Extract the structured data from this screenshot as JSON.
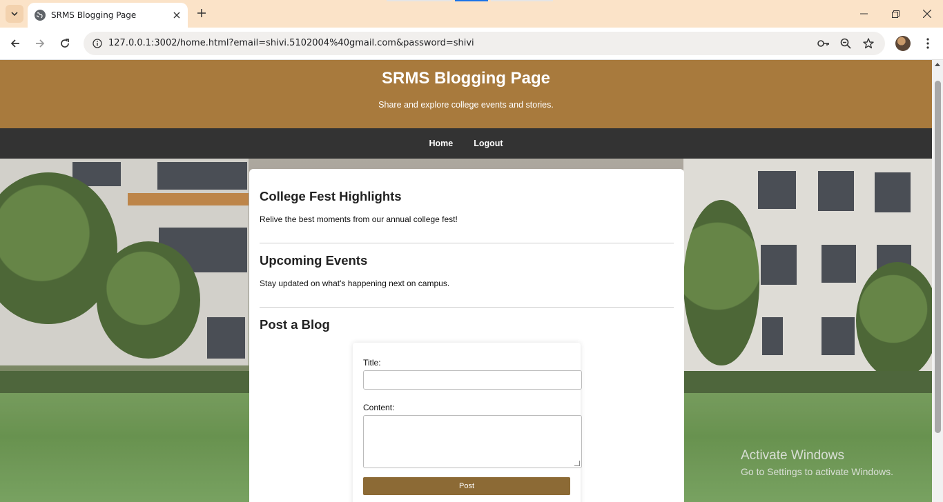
{
  "browser": {
    "tab_title": "SRMS Blogging Page",
    "url": "127.0.0.1:3002/home.html?email=shivi.5102004%40gmail.com&password=shivi",
    "icons": [
      "tab-search-icon",
      "globe-icon",
      "close-icon",
      "plus-icon",
      "minimize-icon",
      "restore-icon",
      "close-window-icon",
      "back-icon",
      "forward-icon",
      "reload-icon",
      "site-info-icon",
      "key-icon",
      "zoom-icon",
      "star-icon",
      "avatar",
      "more-icon"
    ]
  },
  "header": {
    "title": "SRMS Blogging Page",
    "subtitle": "Share and explore college events and stories."
  },
  "nav": {
    "home": "Home",
    "logout": "Logout"
  },
  "sections": [
    {
      "heading": "College Fest Highlights",
      "text": "Relive the best moments from our annual college fest!"
    },
    {
      "heading": "Upcoming Events",
      "text": "Stay updated on what's happening next on campus."
    }
  ],
  "post_form": {
    "heading": "Post a Blog",
    "title_label": "Title:",
    "title_value": "",
    "content_label": "Content:",
    "content_value": "",
    "submit_label": "Post"
  },
  "watermark": {
    "line1": "Activate Windows",
    "line2": "Go to Settings to activate Windows."
  },
  "colors": {
    "header_bg": "#a87a3d",
    "nav_bg": "#333333",
    "button_bg": "#8c6a35",
    "tabbar_bg": "#fbe3c8"
  }
}
